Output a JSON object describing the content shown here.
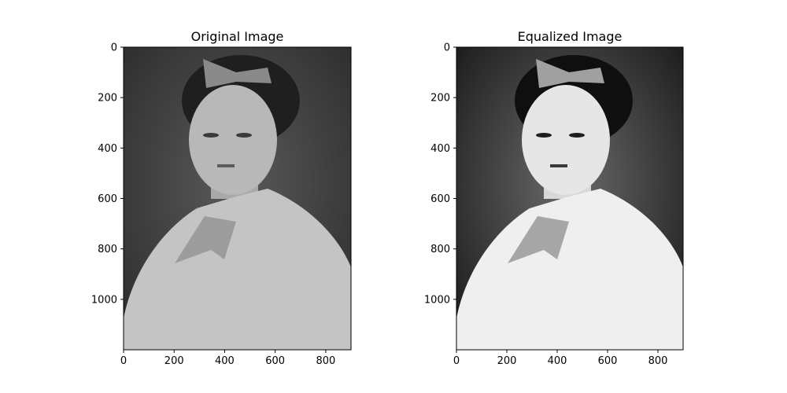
{
  "chart_data": [
    {
      "type": "image",
      "title": "Original Image",
      "xlim": [
        0,
        900
      ],
      "ylim": [
        1200,
        0
      ],
      "x_ticks": [
        0,
        200,
        400,
        600,
        800
      ],
      "y_ticks": [
        0,
        200,
        400,
        600,
        800,
        1000
      ],
      "image_content": "grayscale vintage portrait photograph",
      "contrast": "low"
    },
    {
      "type": "image",
      "title": "Equalized Image",
      "xlim": [
        0,
        900
      ],
      "ylim": [
        1200,
        0
      ],
      "x_ticks": [
        0,
        200,
        400,
        600,
        800
      ],
      "y_ticks": [
        0,
        200,
        400,
        600,
        800,
        1000
      ],
      "image_content": "grayscale vintage portrait photograph, histogram equalized",
      "contrast": "high"
    }
  ],
  "colors": {
    "background": "#ffffff",
    "axes": "#000000",
    "original_dark": "#3a3a3a",
    "original_light": "#bdbdbd",
    "equalized_dark": "#141414",
    "equalized_light": "#f2f2f2"
  }
}
